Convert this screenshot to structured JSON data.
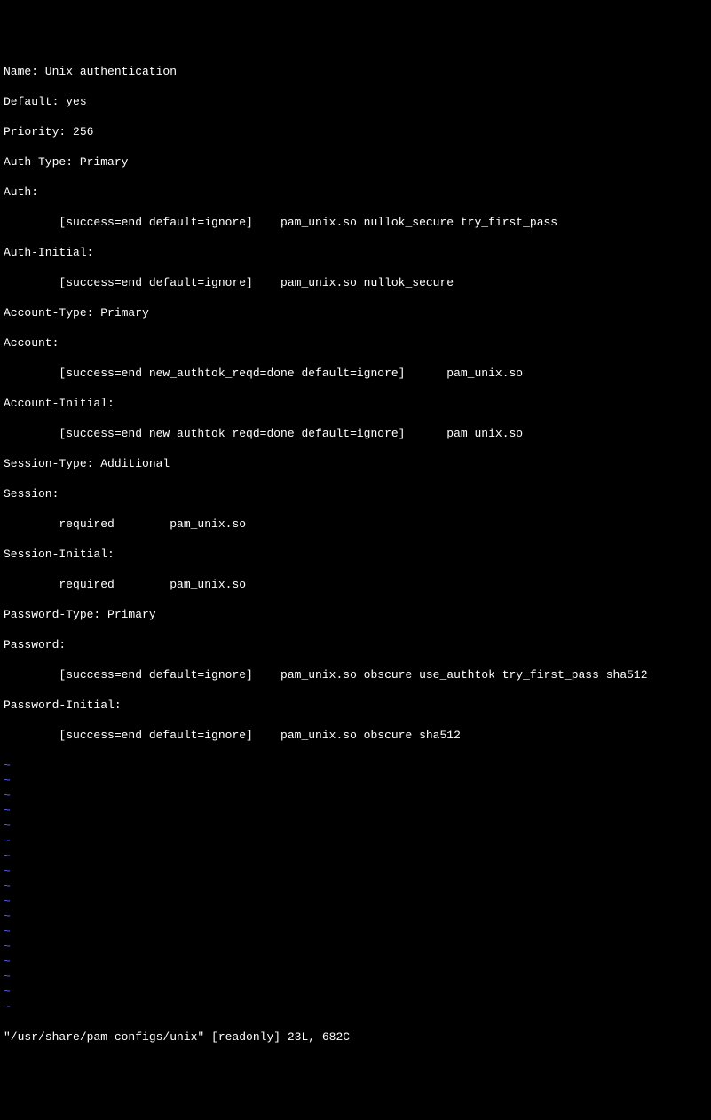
{
  "file": {
    "lines": [
      "Name: Unix authentication",
      "Default: yes",
      "Priority: 256",
      "Auth-Type: Primary",
      "Auth:",
      "        [success=end default=ignore]    pam_unix.so nullok_secure try_first_pass",
      "Auth-Initial:",
      "        [success=end default=ignore]    pam_unix.so nullok_secure",
      "Account-Type: Primary",
      "Account:",
      "        [success=end new_authtok_reqd=done default=ignore]      pam_unix.so",
      "Account-Initial:",
      "        [success=end new_authtok_reqd=done default=ignore]      pam_unix.so",
      "Session-Type: Additional",
      "Session:",
      "        required        pam_unix.so",
      "Session-Initial:",
      "        required        pam_unix.so",
      "Password-Type: Primary",
      "Password:",
      "        [success=end default=ignore]    pam_unix.so obscure use_authtok try_first_pass sha512",
      "Password-Initial:",
      "        [success=end default=ignore]    pam_unix.so obscure sha512"
    ]
  },
  "tilde": "~",
  "tilde_count": 17,
  "status": "\"/usr/share/pam-configs/unix\" [readonly] 23L, 682C"
}
